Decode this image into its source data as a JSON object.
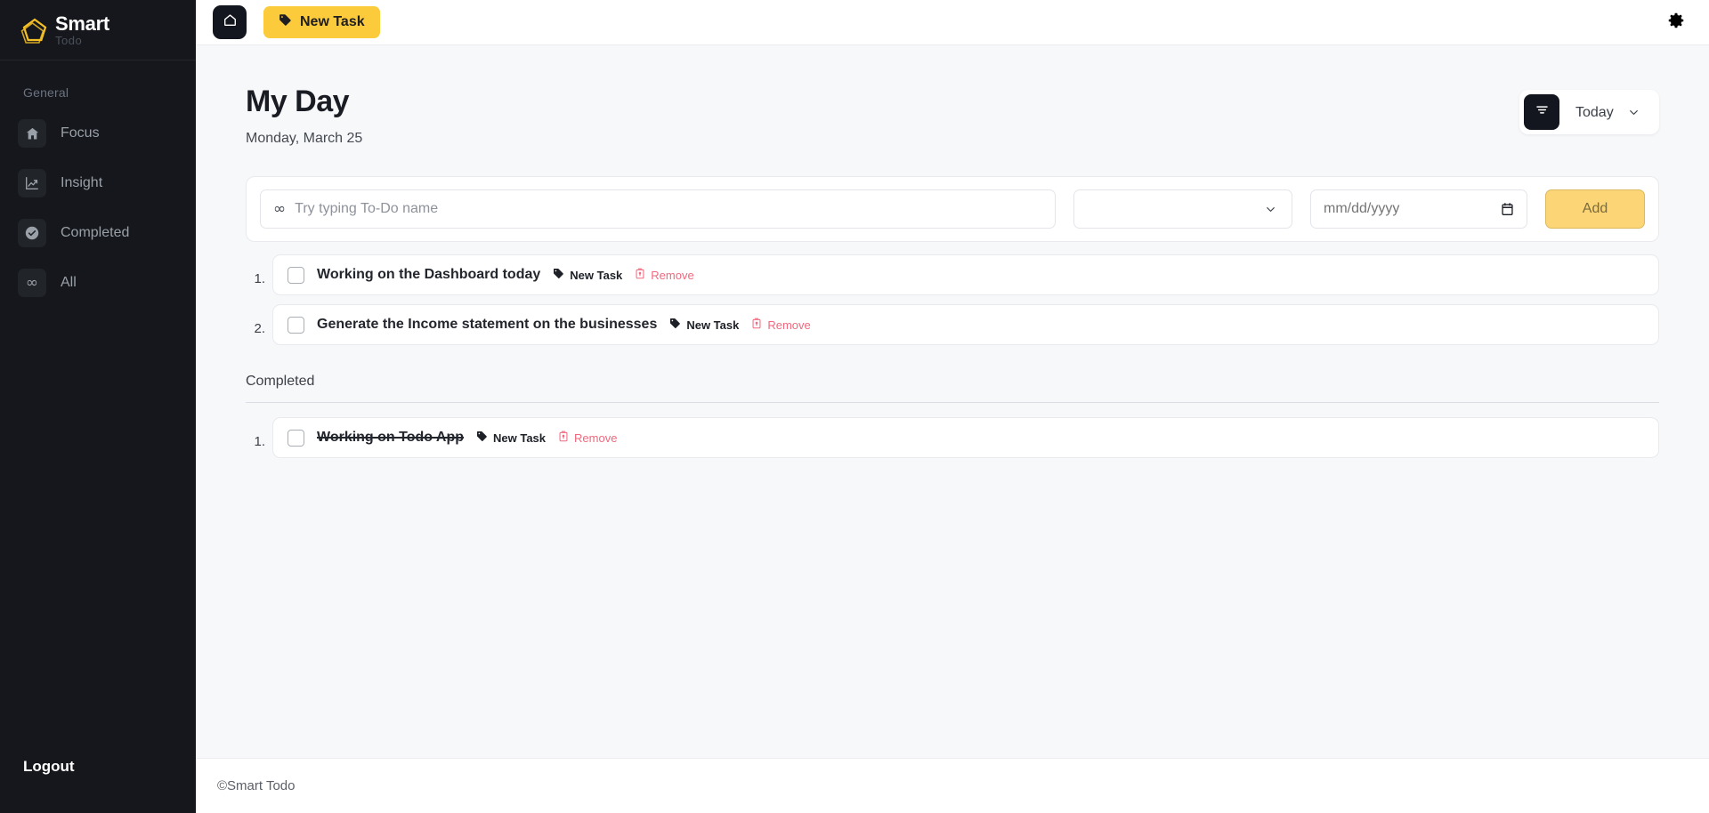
{
  "brand": {
    "title": "Smart",
    "subtitle": "Todo",
    "logo_icon": "pentagon-logo-icon",
    "accent_color": "#fbcb3c"
  },
  "sidebar": {
    "section_label": "General",
    "items": [
      {
        "label": "Focus",
        "icon": "home-icon"
      },
      {
        "label": "Insight",
        "icon": "line-chart-icon"
      },
      {
        "label": "Completed",
        "icon": "check-circle-icon"
      },
      {
        "label": "All",
        "icon": "infinity-icon"
      }
    ],
    "logout_label": "Logout"
  },
  "topbar": {
    "home_icon": "home-icon",
    "new_task_label": "New Task",
    "new_task_icon": "tag-icon",
    "settings_icon": "gear-icon"
  },
  "header": {
    "title": "My Day",
    "date": "Monday, March 25",
    "filter_icon": "filter-icon",
    "range_selected": "Today",
    "range_options": [
      "Today"
    ]
  },
  "add_form": {
    "input_icon": "infinity-icon",
    "input_placeholder": "Try typing To-Do name",
    "input_value": "",
    "category_selected": "",
    "category_options": [
      ""
    ],
    "date_placeholder": "mm/dd/yyyy",
    "date_value": "",
    "date_icon": "calendar-icon",
    "add_label": "Add"
  },
  "tasks": {
    "active": [
      {
        "index": "1.",
        "title": "Working on the Dashboard today",
        "tag_label": "New Task",
        "tag_icon": "tag-icon",
        "remove_label": "Remove",
        "remove_icon": "trash-icon",
        "checked": false
      },
      {
        "index": "2.",
        "title": "Generate the Income statement on the businesses",
        "tag_label": "New Task",
        "tag_icon": "tag-icon",
        "remove_label": "Remove",
        "remove_icon": "trash-icon",
        "checked": false
      }
    ],
    "completed_label": "Completed",
    "completed": [
      {
        "index": "1.",
        "title": "Working on Todo App",
        "tag_label": "New Task",
        "tag_icon": "tag-icon",
        "remove_label": "Remove",
        "remove_icon": "trash-icon",
        "checked": false
      }
    ]
  },
  "footer": {
    "text": "©Smart Todo"
  }
}
